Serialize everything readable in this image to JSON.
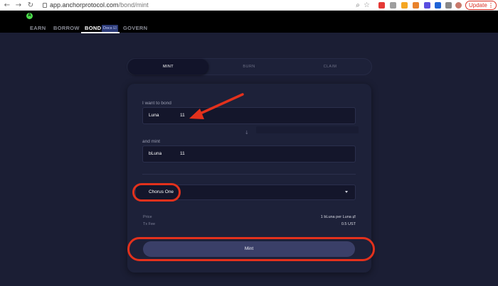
{
  "browser": {
    "url_host": "app.anchorprotocol.com",
    "url_path": "/bond/mint",
    "update_label": "Update",
    "menu_dots": "⋮"
  },
  "nav": {
    "logo_letter": "A",
    "items": [
      "EARN",
      "BORROW",
      "BOND",
      "GOVERN"
    ],
    "active": "BOND",
    "docs_badge": "Docs ☑"
  },
  "tabs": [
    "MINT",
    "BURN",
    "CLAIM"
  ],
  "form": {
    "bond_label": "I want to bond",
    "bond_asset": "Luna",
    "bond_amount": "11",
    "mint_label": "and mint",
    "mint_asset": "bLuna",
    "mint_amount": "11",
    "validator": "Chorus One",
    "price_label": "Price",
    "price_value": "1 bLuna per Luna ⇄",
    "fee_label": "Tx Fee",
    "fee_value": "0.5 UST",
    "submit_label": "Mint"
  },
  "colors": {
    "accent_annotation": "#e3311c",
    "logo_green": "#4bdb4b"
  }
}
